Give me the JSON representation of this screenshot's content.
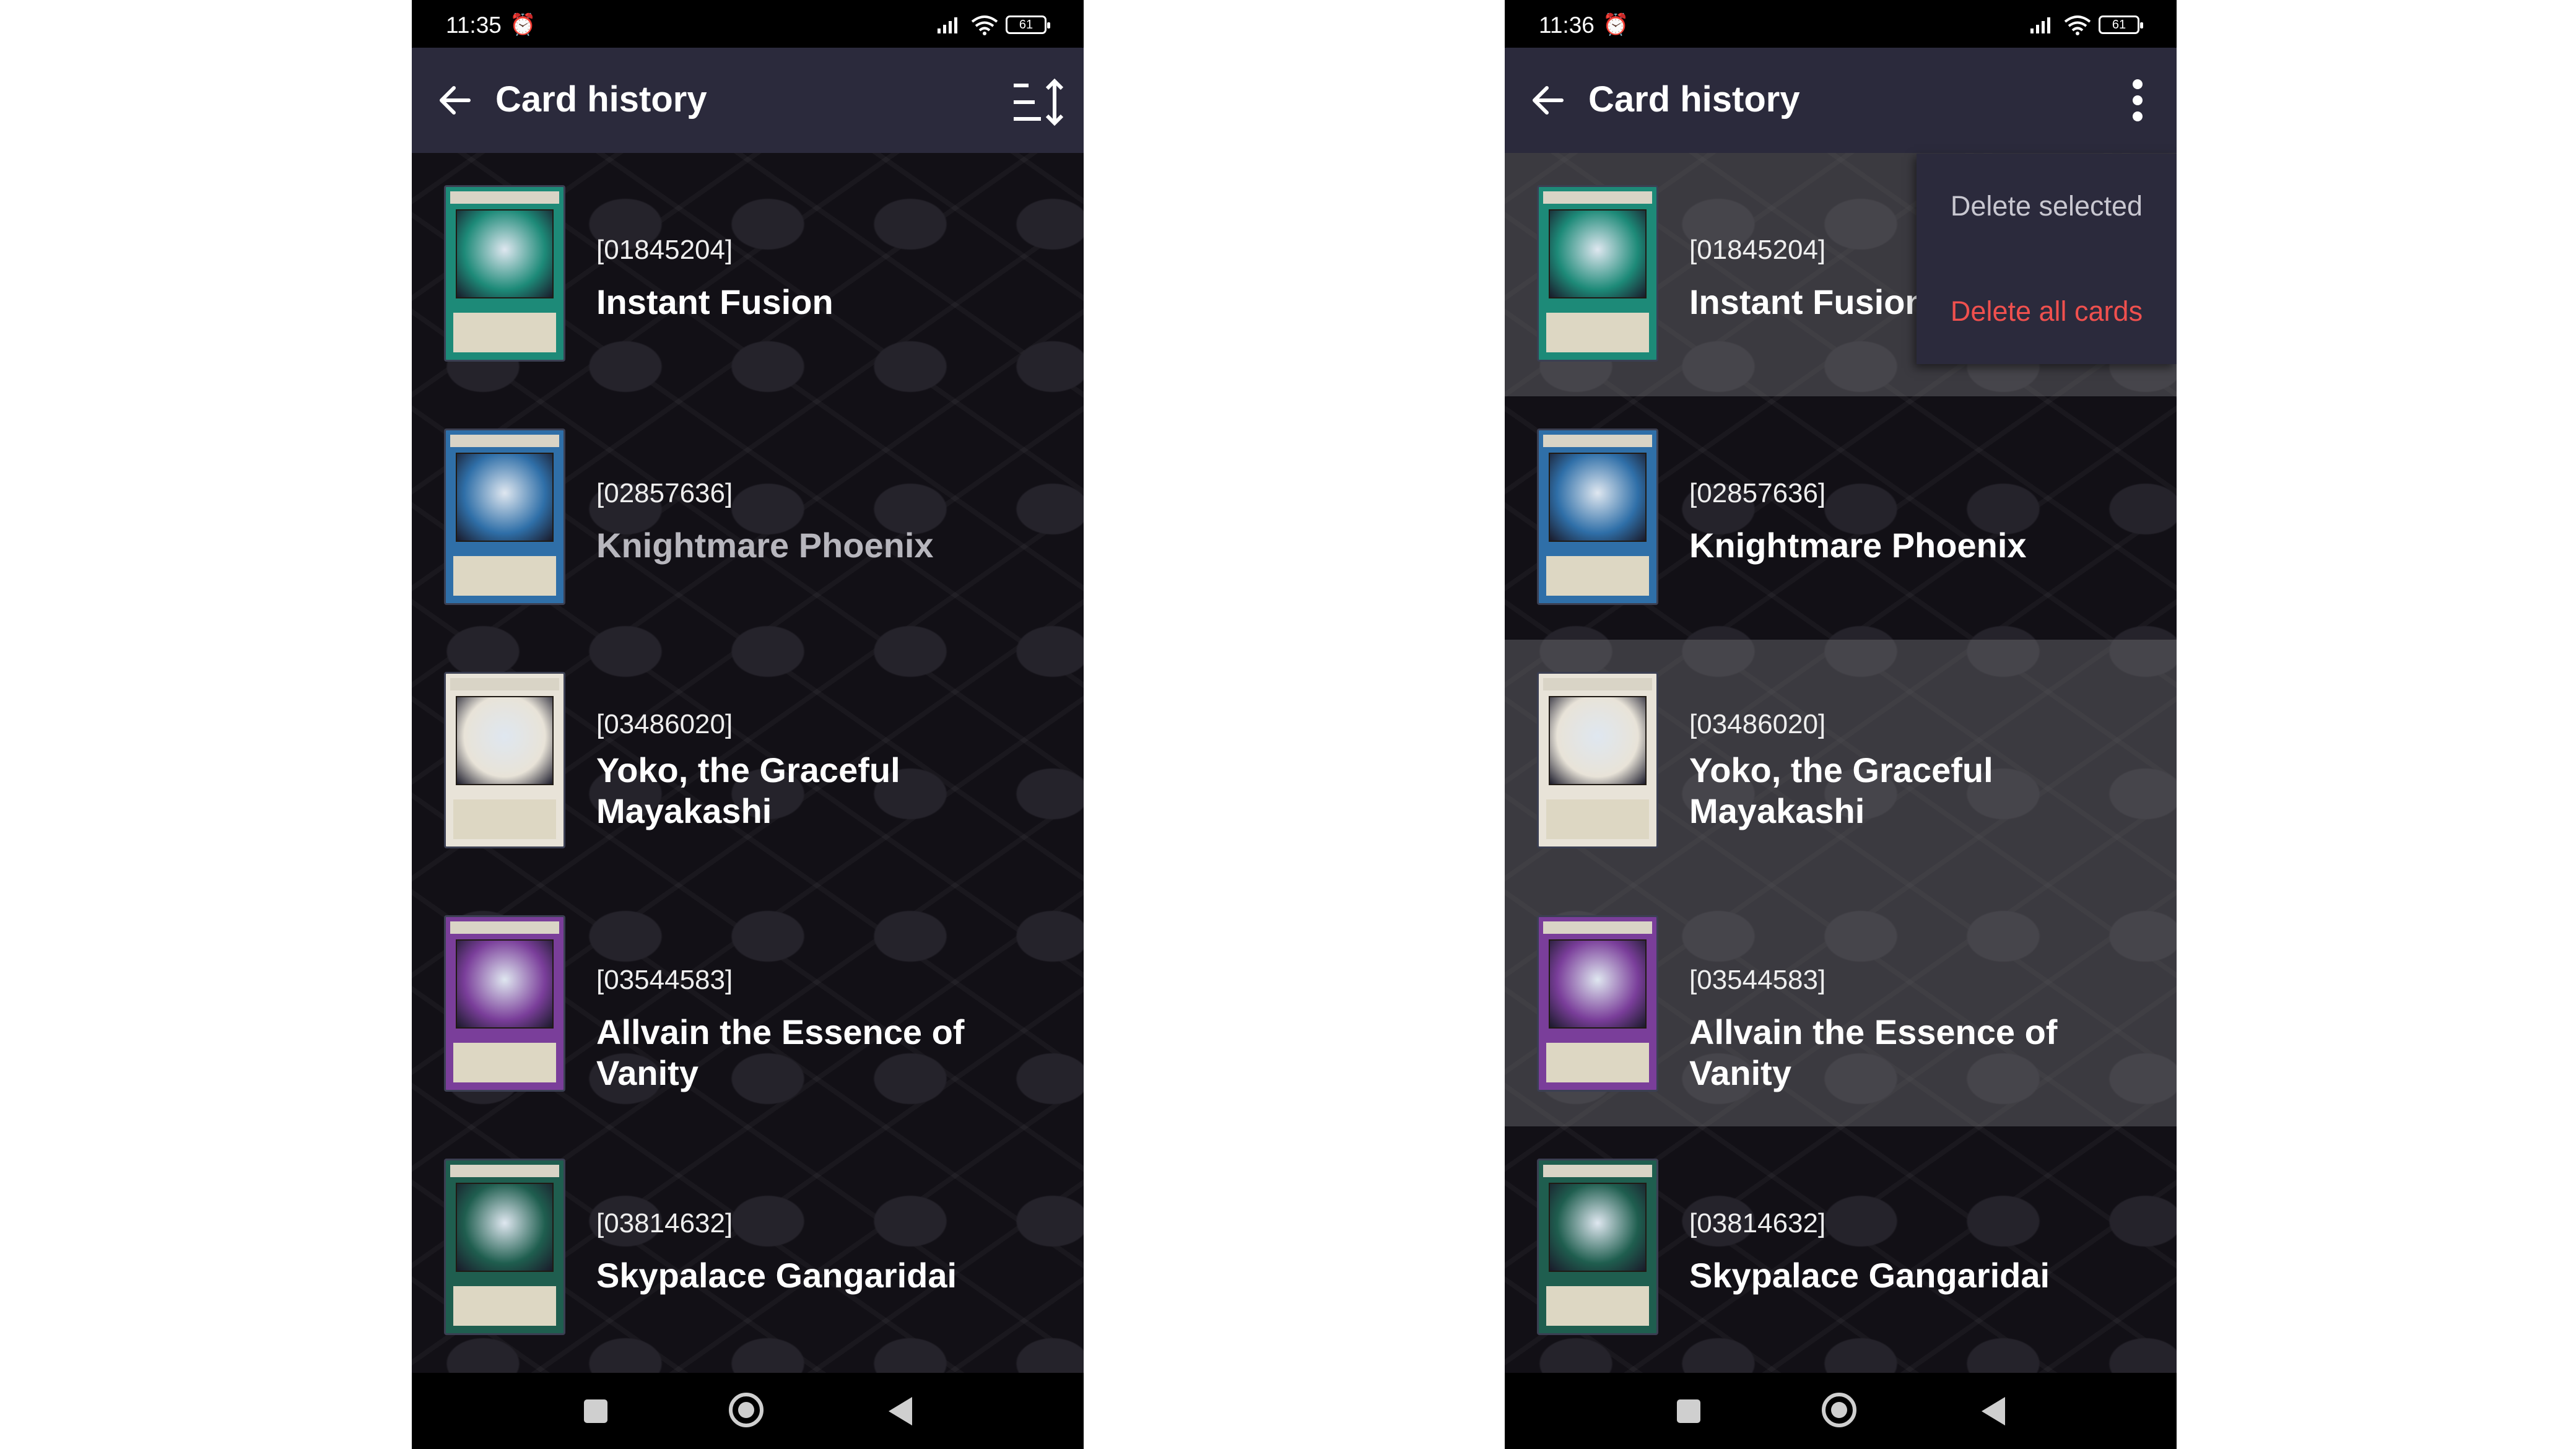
{
  "colors": {
    "appbar": "#2b2a3c",
    "background": "#121016",
    "danger": "#f0504e",
    "statusbar": "#000000"
  },
  "left": {
    "status": {
      "time": "11:35",
      "battery": "61"
    },
    "title": "Card history",
    "cards": [
      {
        "id": "[01845204]",
        "name": "Instant Fusion",
        "frame": "#1d8a78"
      },
      {
        "id": "[02857636]",
        "name": "Knightmare Phoenix",
        "frame": "#2f6fa8"
      },
      {
        "id": "[03486020]",
        "name": "Yoko, the Graceful Mayakashi",
        "frame": "#e8e3d8"
      },
      {
        "id": "[03544583]",
        "name": "Allvain the Essence of Vanity",
        "frame": "#7a3e9a"
      },
      {
        "id": "[03814632]",
        "name": "Skypalace Gangaridai",
        "frame": "#1f5e4f"
      }
    ]
  },
  "right": {
    "status": {
      "time": "11:36",
      "battery": "61"
    },
    "title": "Card history",
    "menu": {
      "delete_selected": "Delete selected",
      "delete_all": "Delete all cards"
    },
    "cards": [
      {
        "id": "[01845204]",
        "name": "Instant Fusion",
        "frame": "#1d8a78",
        "selected": true
      },
      {
        "id": "[02857636]",
        "name": "Knightmare Phoenix",
        "frame": "#2f6fa8",
        "selected": false
      },
      {
        "id": "[03486020]",
        "name": "Yoko, the Graceful Mayakashi",
        "frame": "#e8e3d8",
        "selected": true
      },
      {
        "id": "[03544583]",
        "name": "Allvain the Essence of Vanity",
        "frame": "#7a3e9a",
        "selected": true
      },
      {
        "id": "[03814632]",
        "name": "Skypalace Gangaridai",
        "frame": "#1f5e4f",
        "selected": false
      }
    ]
  },
  "icons": {
    "back": "arrow-left-icon",
    "sort": "sort-icon",
    "more": "more-vert-icon",
    "alarm_off": "alarm-off-icon",
    "signal": "signal-icon",
    "wifi": "wifi-icon",
    "battery": "battery-icon",
    "nav_recents": "recents-icon",
    "nav_home": "home-icon",
    "nav_back": "nav-back-icon"
  }
}
